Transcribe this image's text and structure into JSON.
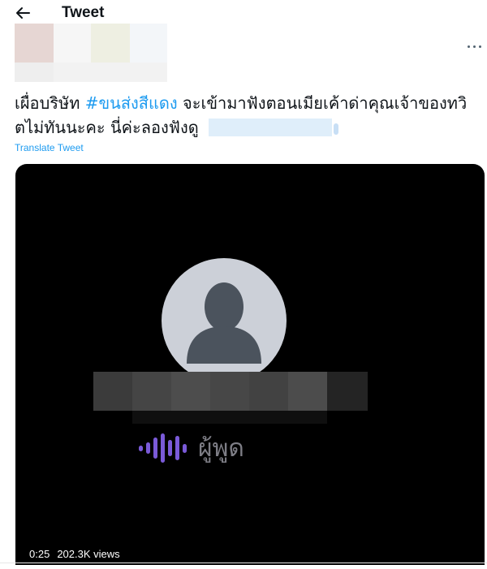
{
  "header": {
    "title": "Tweet",
    "back_icon": "arrow-left-icon"
  },
  "tweet": {
    "text_before": "เผื่อบริษัท ",
    "hashtag": "#ขนส่งสีแดง",
    "text_after": " จะเข้ามาฟังตอนเมียเค้าด่าคุณเจ้าของทวิตไม่ทันนะคะ นี่ค่ะลองฟังดู ",
    "translate_label": "Translate Tweet",
    "more_icon": "more-dots-icon",
    "link_color": "#1d9bf0"
  },
  "video": {
    "speaker_label": "ผู้พูด",
    "speaker_icon": "audio-wave-icon",
    "duration": "0:25",
    "views": "202.3K views",
    "wave_color": "#7a5ad8"
  }
}
